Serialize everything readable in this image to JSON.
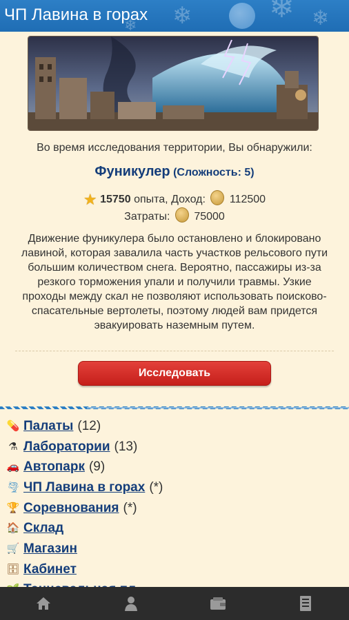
{
  "header": {
    "title": "ЧП Лавина в горах"
  },
  "event": {
    "intro": "Во время исследования территории, Вы обнаружили:",
    "name": "Фуникулер",
    "difficulty": "(Сложность: 5)",
    "exp_value": "15750",
    "exp_label": "опыта, Доход:",
    "income_value": "112500",
    "cost_label": "Затраты:",
    "cost_value": "75000",
    "description": "Движение фуникулера было остановлено и блокировано лавиной, которая завалила часть участков рельсового пути большим количеством снега. Вероятно, пассажиры из-за резкого торможения упали и получили травмы. Узкие проходы между скал не позволяют использовать поисково-спасательные вертолеты, поэтому людей вам придется эвакуировать наземным путем.",
    "explore_button": "Исследовать"
  },
  "menu": [
    {
      "label": "Палаты",
      "count": "(12)",
      "icon": "pill-icon"
    },
    {
      "label": "Лаборатории",
      "count": "(13)",
      "icon": "flask-icon"
    },
    {
      "label": "Автопарк",
      "count": "(9)",
      "icon": "car-icon"
    },
    {
      "label": "ЧП Лавина в горах",
      "count": "(*)",
      "icon": "tornado-icon"
    },
    {
      "label": "Соревнования",
      "count": "(*)",
      "icon": "trophy-icon"
    },
    {
      "label": "Склад",
      "count": "",
      "icon": "house-icon"
    },
    {
      "label": "Магазин",
      "count": "",
      "icon": "cart-icon"
    },
    {
      "label": "Кабинет",
      "count": "",
      "icon": "cabinet-icon"
    },
    {
      "label": "Танцевальная пл...",
      "count": "",
      "icon": "plant-icon"
    }
  ],
  "bottom_nav": [
    {
      "name": "home-icon"
    },
    {
      "name": "profile-icon"
    },
    {
      "name": "wallet-icon"
    },
    {
      "name": "document-icon"
    }
  ],
  "colors": {
    "header": "#2377bf",
    "background": "#fdf3dc",
    "button": "#d3302a",
    "link": "#143d7a",
    "bottom_bar": "#2c2c2c"
  }
}
